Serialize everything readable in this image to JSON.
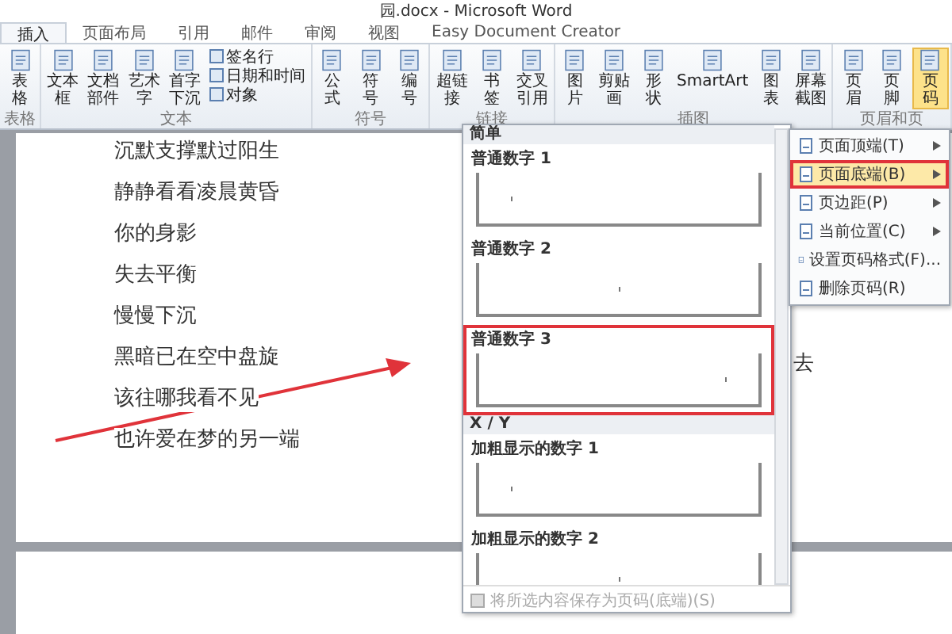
{
  "window": {
    "title": "园.docx - Microsoft Word"
  },
  "tabs": [
    {
      "label": "插入",
      "selected": true
    },
    {
      "label": "页面布局",
      "selected": false
    },
    {
      "label": "引用",
      "selected": false
    },
    {
      "label": "邮件",
      "selected": false
    },
    {
      "label": "审阅",
      "selected": false
    },
    {
      "label": "视图",
      "selected": false
    },
    {
      "label": "Easy Document Creator",
      "selected": false
    }
  ],
  "ribbon": [
    {
      "name": "表格",
      "buttons": [
        {
          "kind": "large",
          "label": "表格",
          "selected": false
        }
      ]
    },
    {
      "name": "文本",
      "buttons": [
        {
          "kind": "large",
          "label": "文本框",
          "selected": false
        },
        {
          "kind": "large",
          "label": "文档部件",
          "selected": false
        },
        {
          "kind": "large",
          "label": "艺术字",
          "selected": false
        },
        {
          "kind": "large",
          "label": "首字下沉",
          "selected": false
        },
        {
          "kind": "small",
          "label": "签名行",
          "selected": false
        },
        {
          "kind": "small",
          "label": "日期和时间",
          "selected": false
        },
        {
          "kind": "small",
          "label": "对象",
          "selected": false
        }
      ]
    },
    {
      "name": "符号",
      "buttons": [
        {
          "kind": "large",
          "label": "公式",
          "selected": false
        },
        {
          "kind": "large",
          "label": "符号",
          "selected": false
        },
        {
          "kind": "large",
          "label": "编号",
          "selected": false
        }
      ]
    },
    {
      "name": "链接",
      "buttons": [
        {
          "kind": "large",
          "label": "超链接",
          "selected": false
        },
        {
          "kind": "large",
          "label": "书签",
          "selected": false
        },
        {
          "kind": "large",
          "label": "交叉引用",
          "selected": false
        }
      ]
    },
    {
      "name": "插图",
      "buttons": [
        {
          "kind": "large",
          "label": "图片",
          "selected": false
        },
        {
          "kind": "large",
          "label": "剪贴画",
          "selected": false
        },
        {
          "kind": "large",
          "label": "形状",
          "selected": false
        },
        {
          "kind": "large",
          "label": "SmartArt",
          "selected": false
        },
        {
          "kind": "large",
          "label": "图表",
          "selected": false
        },
        {
          "kind": "large",
          "label": "屏幕截图",
          "selected": false
        }
      ]
    },
    {
      "name": "页眉和页",
      "buttons": [
        {
          "kind": "large",
          "label": "页眉",
          "selected": false
        },
        {
          "kind": "large",
          "label": "页脚",
          "selected": false
        },
        {
          "kind": "large",
          "label": "页码",
          "selected": true
        }
      ]
    }
  ],
  "document": {
    "lines": [
      "沉默支撑默过阳生",
      "静静看看凌晨黄昏",
      "你的身影",
      "失去平衡",
      "慢慢下沉",
      "黑暗已在空中盘旋",
      "该往哪我看不见",
      "也许爱在梦的另一端"
    ],
    "right_fragment": "去"
  },
  "gallery": {
    "sections": [
      {
        "title": "简单",
        "items": [
          {
            "label": "普通数字 1",
            "kind": "left",
            "highlighted": false
          },
          {
            "label": "普通数字 2",
            "kind": "center",
            "highlighted": false
          },
          {
            "label": "普通数字 3",
            "kind": "right",
            "highlighted": true
          }
        ]
      },
      {
        "title": "X / Y",
        "items": [
          {
            "label": "加粗显示的数字 1",
            "kind": "left",
            "highlighted": false
          },
          {
            "label": "加粗显示的数字 2",
            "kind": "center",
            "highlighted": false
          }
        ]
      }
    ],
    "footer": "将所选内容保存为页码(底端)(S)"
  },
  "menu": [
    {
      "label": "页面顶端(T)",
      "submenu": true,
      "selected": false
    },
    {
      "label": "页面底端(B)",
      "submenu": true,
      "selected": true
    },
    {
      "label": "页边距(P)",
      "submenu": true,
      "selected": false
    },
    {
      "label": "当前位置(C)",
      "submenu": true,
      "selected": false
    },
    {
      "label": "设置页码格式(F)...",
      "submenu": false,
      "selected": false
    },
    {
      "label": "删除页码(R)",
      "submenu": false,
      "selected": false
    }
  ]
}
